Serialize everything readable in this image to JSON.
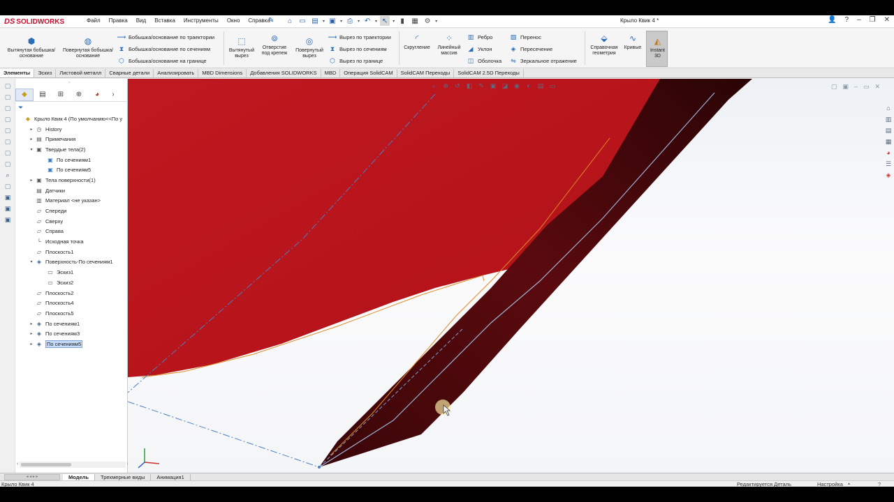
{
  "window": {
    "doc_title": "Крыло Квик 4 *"
  },
  "brand": {
    "ds": "DS",
    "name": "SOLIDWORKS"
  },
  "menu": [
    "Файл",
    "Правка",
    "Вид",
    "Вставка",
    "Инструменты",
    "Окно",
    "Справка"
  ],
  "ribbon": {
    "extrude_boss": "Вытянутая бобышка/основание",
    "revolve_boss": "Повернутая бобышка/основание",
    "sweep_boss": "Бобышка/основание по траектории",
    "loft_boss": "Бобышка/основание по сечениям",
    "boundary_boss": "Бобышка/основание на границе",
    "extrude_cut": "Вытянутый вырез",
    "hole_wizard": "Отверстие под крепеж",
    "revolve_cut": "Повернутый вырез",
    "sweep_cut": "Вырез по траектории",
    "loft_cut": "Вырез по сечениям",
    "boundary_cut": "Вырез по границе",
    "fillet": "Скругление",
    "linear_pattern": "Линейный массив",
    "rib": "Ребро",
    "draft": "Уклон",
    "shell": "Оболочка",
    "wrap": "Перенос",
    "intersect": "Пересечение",
    "mirror": "Зеркальное отражение",
    "ref_geometry": "Справочная геометрия",
    "curves": "Кривые",
    "instant3d": "Instant 3D"
  },
  "tabs": [
    "Элементы",
    "Эскиз",
    "Листовой металл",
    "Сварные детали",
    "Анализировать",
    "MBD Dimensions",
    "Добавления SOLIDWORKS",
    "MBD",
    "Операция SolidCAM",
    "SolidCAM Переходы",
    "SolidCAM 2.5D Переходы"
  ],
  "tree": [
    {
      "label": "Крыло Квик 4  (По умолчанию<<По у",
      "level": 0,
      "arrow": "",
      "icon": "part-icon"
    },
    {
      "label": "History",
      "level": 1,
      "arrow": "▸",
      "icon": "history-icon"
    },
    {
      "label": "Примечания",
      "level": 1,
      "arrow": "▸",
      "icon": "annotations-icon"
    },
    {
      "label": "Твердые тела(2)",
      "level": 1,
      "arrow": "▾",
      "icon": "solid-bodies-icon"
    },
    {
      "label": "По сечениям1",
      "level": 2,
      "arrow": "",
      "icon": "body-icon"
    },
    {
      "label": "По сечениям5",
      "level": 2,
      "arrow": "",
      "icon": "body-icon"
    },
    {
      "label": "Тела поверхности(1)",
      "level": 1,
      "arrow": "▸",
      "icon": "surface-bodies-icon"
    },
    {
      "label": "Датчики",
      "level": 1,
      "arrow": "",
      "icon": "sensors-icon"
    },
    {
      "label": "Материал <не указан>",
      "level": 1,
      "arrow": "",
      "icon": "material-icon"
    },
    {
      "label": "Спереди",
      "level": 1,
      "arrow": "",
      "icon": "plane-icon"
    },
    {
      "label": "Сверху",
      "level": 1,
      "arrow": "",
      "icon": "plane-icon"
    },
    {
      "label": "Справа",
      "level": 1,
      "arrow": "",
      "icon": "plane-icon"
    },
    {
      "label": "Исходная точка",
      "level": 1,
      "arrow": "",
      "icon": "origin-icon"
    },
    {
      "label": "Плоскость1",
      "level": 1,
      "arrow": "",
      "icon": "plane-icon"
    },
    {
      "label": "Поверхность-По сечениям1",
      "level": 1,
      "arrow": "▾",
      "icon": "loft-surface-icon"
    },
    {
      "label": "Эскиз1",
      "level": 2,
      "arrow": "",
      "icon": "sketch-icon"
    },
    {
      "label": "Эскиз2",
      "level": 2,
      "arrow": "",
      "icon": "sketch-icon"
    },
    {
      "label": "Плоскость2",
      "level": 1,
      "arrow": "",
      "icon": "plane-icon"
    },
    {
      "label": "Плоскость4",
      "level": 1,
      "arrow": "",
      "icon": "plane-icon"
    },
    {
      "label": "Плоскость5",
      "level": 1,
      "arrow": "",
      "icon": "plane-icon"
    },
    {
      "label": "По сечениям1",
      "level": 1,
      "arrow": "▸",
      "icon": "loft-icon"
    },
    {
      "label": "По сечениям3",
      "level": 1,
      "arrow": "▸",
      "icon": "loft-icon"
    },
    {
      "label": "По сечениям5",
      "level": 1,
      "arrow": "▸",
      "icon": "loft-icon",
      "selected": true
    }
  ],
  "bottom_tabs": [
    "Модель",
    "Трехмерные виды",
    "Анимация1"
  ],
  "status": {
    "doc": "Крыло Квик 4",
    "mode": "Редактируется Деталь",
    "custom": "Настройка",
    "help": "?"
  },
  "colors": {
    "wing_red": "#b5131a",
    "edge_orange": "#e08a2a",
    "sketch_blue": "#4a7fc1",
    "selection": "#c6daf5"
  }
}
